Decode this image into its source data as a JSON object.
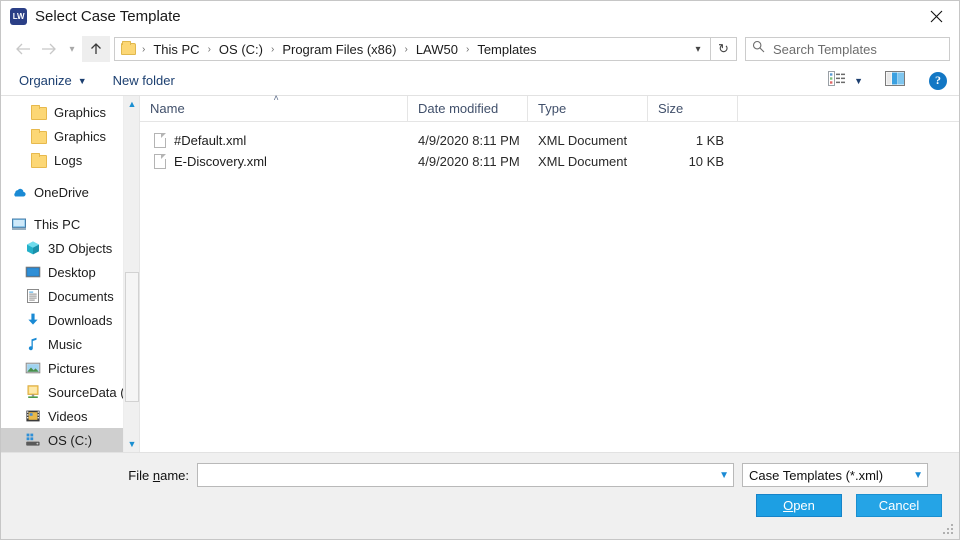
{
  "window": {
    "title": "Select Case Template",
    "app_icon": "LW",
    "close_label": "close-window"
  },
  "nav": {
    "back": "back-arrow",
    "forward": "forward-arrow",
    "recent": "recent-locations-chevron",
    "up": "up-arrow",
    "refresh": "refresh-arrow",
    "dropdown": "address-dropdown-chevron",
    "breadcrumbs": [
      "This PC",
      "OS (C:)",
      "Program Files (x86)",
      "LAW50",
      "Templates"
    ],
    "separator": "›"
  },
  "search": {
    "placeholder": "Search Templates",
    "icon": "search-icon"
  },
  "toolbar": {
    "organize_label": "Organize",
    "new_folder_label": "New folder",
    "view_icon": "details-view-icon",
    "preview_pane_icon": "preview-pane-icon",
    "help_label": "?"
  },
  "sidebar": {
    "items": [
      {
        "label": "Graphics",
        "icon": "folder-icon",
        "indent": 1,
        "selected": false
      },
      {
        "label": "Graphics",
        "icon": "folder-icon",
        "indent": 1,
        "selected": false
      },
      {
        "label": "Logs",
        "icon": "folder-icon",
        "indent": 1,
        "selected": false
      },
      {
        "label": "OneDrive",
        "icon": "onedrive-icon",
        "indent": 0,
        "selected": false
      },
      {
        "label": "This PC",
        "icon": "this-pc-icon",
        "indent": 0,
        "selected": false
      },
      {
        "label": "3D Objects",
        "icon": "3d-objects-icon",
        "indent": 2,
        "selected": false
      },
      {
        "label": "Desktop",
        "icon": "desktop-icon",
        "indent": 2,
        "selected": false
      },
      {
        "label": "Documents",
        "icon": "documents-icon",
        "indent": 2,
        "selected": false
      },
      {
        "label": "Downloads",
        "icon": "downloads-icon",
        "indent": 2,
        "selected": false
      },
      {
        "label": "Music",
        "icon": "music-icon",
        "indent": 2,
        "selected": false
      },
      {
        "label": "Pictures",
        "icon": "pictures-icon",
        "indent": 2,
        "selected": false
      },
      {
        "label": "SourceData (Cev",
        "icon": "network-drive-icon",
        "indent": 2,
        "selected": false
      },
      {
        "label": "Videos",
        "icon": "videos-icon",
        "indent": 2,
        "selected": false
      },
      {
        "label": "OS (C:)",
        "icon": "local-disk-icon",
        "indent": 2,
        "selected": true
      }
    ],
    "scroll_up": "scroll-up-arrow",
    "scroll_down": "scroll-down-arrow"
  },
  "filelist": {
    "columns": [
      "Name",
      "Date modified",
      "Type",
      "Size"
    ],
    "sort_column": "Name",
    "sort_caret": "˄",
    "rows": [
      {
        "name": "#Default.xml",
        "date": "4/9/2020 8:11 PM",
        "type": "XML Document",
        "size": "1 KB"
      },
      {
        "name": "E-Discovery.xml",
        "date": "4/9/2020 8:11 PM",
        "type": "XML Document",
        "size": "10 KB"
      }
    ]
  },
  "footer": {
    "file_name_label_pre": "File ",
    "file_name_label_accel": "n",
    "file_name_label_post": "ame:",
    "file_name_value": "",
    "file_type_value": "Case Templates (*.xml)",
    "open_label_accel": "O",
    "open_label_post": "pen",
    "cancel_label": "Cancel"
  },
  "colors": {
    "accent_blue": "#1d9fe3",
    "link_blue": "#1c3f70",
    "folder_yellow": "#fcd775",
    "selection_gray": "#cfcfcf"
  }
}
